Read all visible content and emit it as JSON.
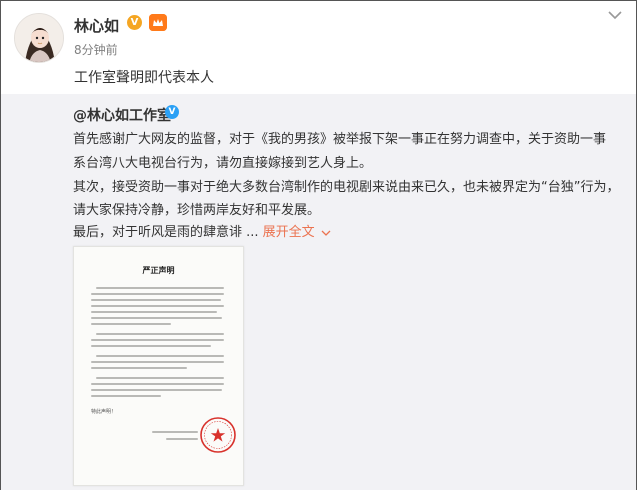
{
  "post": {
    "username": "林心如",
    "time": "8分钟前",
    "text": "工作室聲明即代表本人",
    "verified_badge": "V"
  },
  "repost": {
    "author": "@林心如工作室",
    "verified_badge": "V",
    "lines": [
      "首先感谢广大网友的监督，对于《我的男孩》被举报下架一事正在努力调查中，关于资助一事",
      "系台湾八大电视台行为，请勿直接嫁接到艺人身上。",
      "其次，接受资助一事对于绝大多数台湾制作的电视剧来说由来已久，也未被界定为“台独”行为，",
      "请大家保持冷静，珍惜两岸友好和平发展。",
      "最后，对于听风是雨的肆意诽 ..."
    ],
    "expand_label": "展开全文",
    "expand_icon": "chevron-down-icon",
    "document": {
      "title": "严正声明",
      "closing": "特此声明！"
    }
  },
  "colors": {
    "link_orange": "#eb7350",
    "repost_bg": "#f2f2f5",
    "verified_orange": "#f5a623",
    "verified_blue": "#2aa0f5",
    "stamp_red": "#d8322c"
  }
}
